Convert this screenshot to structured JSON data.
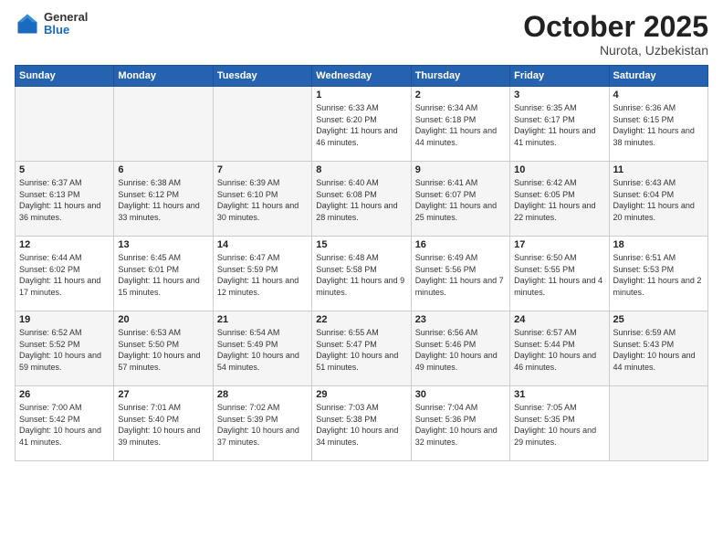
{
  "header": {
    "logo": {
      "general": "General",
      "blue": "Blue"
    },
    "title": "October 2025",
    "subtitle": "Nurota, Uzbekistan"
  },
  "weekdays": [
    "Sunday",
    "Monday",
    "Tuesday",
    "Wednesday",
    "Thursday",
    "Friday",
    "Saturday"
  ],
  "rows": [
    {
      "cells": [
        {
          "empty": true
        },
        {
          "empty": true
        },
        {
          "empty": true
        },
        {
          "day": "1",
          "sunrise": "Sunrise: 6:33 AM",
          "sunset": "Sunset: 6:20 PM",
          "daylight": "Daylight: 11 hours and 46 minutes."
        },
        {
          "day": "2",
          "sunrise": "Sunrise: 6:34 AM",
          "sunset": "Sunset: 6:18 PM",
          "daylight": "Daylight: 11 hours and 44 minutes."
        },
        {
          "day": "3",
          "sunrise": "Sunrise: 6:35 AM",
          "sunset": "Sunset: 6:17 PM",
          "daylight": "Daylight: 11 hours and 41 minutes."
        },
        {
          "day": "4",
          "sunrise": "Sunrise: 6:36 AM",
          "sunset": "Sunset: 6:15 PM",
          "daylight": "Daylight: 11 hours and 38 minutes."
        }
      ]
    },
    {
      "cells": [
        {
          "day": "5",
          "sunrise": "Sunrise: 6:37 AM",
          "sunset": "Sunset: 6:13 PM",
          "daylight": "Daylight: 11 hours and 36 minutes."
        },
        {
          "day": "6",
          "sunrise": "Sunrise: 6:38 AM",
          "sunset": "Sunset: 6:12 PM",
          "daylight": "Daylight: 11 hours and 33 minutes."
        },
        {
          "day": "7",
          "sunrise": "Sunrise: 6:39 AM",
          "sunset": "Sunset: 6:10 PM",
          "daylight": "Daylight: 11 hours and 30 minutes."
        },
        {
          "day": "8",
          "sunrise": "Sunrise: 6:40 AM",
          "sunset": "Sunset: 6:08 PM",
          "daylight": "Daylight: 11 hours and 28 minutes."
        },
        {
          "day": "9",
          "sunrise": "Sunrise: 6:41 AM",
          "sunset": "Sunset: 6:07 PM",
          "daylight": "Daylight: 11 hours and 25 minutes."
        },
        {
          "day": "10",
          "sunrise": "Sunrise: 6:42 AM",
          "sunset": "Sunset: 6:05 PM",
          "daylight": "Daylight: 11 hours and 22 minutes."
        },
        {
          "day": "11",
          "sunrise": "Sunrise: 6:43 AM",
          "sunset": "Sunset: 6:04 PM",
          "daylight": "Daylight: 11 hours and 20 minutes."
        }
      ]
    },
    {
      "cells": [
        {
          "day": "12",
          "sunrise": "Sunrise: 6:44 AM",
          "sunset": "Sunset: 6:02 PM",
          "daylight": "Daylight: 11 hours and 17 minutes."
        },
        {
          "day": "13",
          "sunrise": "Sunrise: 6:45 AM",
          "sunset": "Sunset: 6:01 PM",
          "daylight": "Daylight: 11 hours and 15 minutes."
        },
        {
          "day": "14",
          "sunrise": "Sunrise: 6:47 AM",
          "sunset": "Sunset: 5:59 PM",
          "daylight": "Daylight: 11 hours and 12 minutes."
        },
        {
          "day": "15",
          "sunrise": "Sunrise: 6:48 AM",
          "sunset": "Sunset: 5:58 PM",
          "daylight": "Daylight: 11 hours and 9 minutes."
        },
        {
          "day": "16",
          "sunrise": "Sunrise: 6:49 AM",
          "sunset": "Sunset: 5:56 PM",
          "daylight": "Daylight: 11 hours and 7 minutes."
        },
        {
          "day": "17",
          "sunrise": "Sunrise: 6:50 AM",
          "sunset": "Sunset: 5:55 PM",
          "daylight": "Daylight: 11 hours and 4 minutes."
        },
        {
          "day": "18",
          "sunrise": "Sunrise: 6:51 AM",
          "sunset": "Sunset: 5:53 PM",
          "daylight": "Daylight: 11 hours and 2 minutes."
        }
      ]
    },
    {
      "cells": [
        {
          "day": "19",
          "sunrise": "Sunrise: 6:52 AM",
          "sunset": "Sunset: 5:52 PM",
          "daylight": "Daylight: 10 hours and 59 minutes."
        },
        {
          "day": "20",
          "sunrise": "Sunrise: 6:53 AM",
          "sunset": "Sunset: 5:50 PM",
          "daylight": "Daylight: 10 hours and 57 minutes."
        },
        {
          "day": "21",
          "sunrise": "Sunrise: 6:54 AM",
          "sunset": "Sunset: 5:49 PM",
          "daylight": "Daylight: 10 hours and 54 minutes."
        },
        {
          "day": "22",
          "sunrise": "Sunrise: 6:55 AM",
          "sunset": "Sunset: 5:47 PM",
          "daylight": "Daylight: 10 hours and 51 minutes."
        },
        {
          "day": "23",
          "sunrise": "Sunrise: 6:56 AM",
          "sunset": "Sunset: 5:46 PM",
          "daylight": "Daylight: 10 hours and 49 minutes."
        },
        {
          "day": "24",
          "sunrise": "Sunrise: 6:57 AM",
          "sunset": "Sunset: 5:44 PM",
          "daylight": "Daylight: 10 hours and 46 minutes."
        },
        {
          "day": "25",
          "sunrise": "Sunrise: 6:59 AM",
          "sunset": "Sunset: 5:43 PM",
          "daylight": "Daylight: 10 hours and 44 minutes."
        }
      ]
    },
    {
      "cells": [
        {
          "day": "26",
          "sunrise": "Sunrise: 7:00 AM",
          "sunset": "Sunset: 5:42 PM",
          "daylight": "Daylight: 10 hours and 41 minutes."
        },
        {
          "day": "27",
          "sunrise": "Sunrise: 7:01 AM",
          "sunset": "Sunset: 5:40 PM",
          "daylight": "Daylight: 10 hours and 39 minutes."
        },
        {
          "day": "28",
          "sunrise": "Sunrise: 7:02 AM",
          "sunset": "Sunset: 5:39 PM",
          "daylight": "Daylight: 10 hours and 37 minutes."
        },
        {
          "day": "29",
          "sunrise": "Sunrise: 7:03 AM",
          "sunset": "Sunset: 5:38 PM",
          "daylight": "Daylight: 10 hours and 34 minutes."
        },
        {
          "day": "30",
          "sunrise": "Sunrise: 7:04 AM",
          "sunset": "Sunset: 5:36 PM",
          "daylight": "Daylight: 10 hours and 32 minutes."
        },
        {
          "day": "31",
          "sunrise": "Sunrise: 7:05 AM",
          "sunset": "Sunset: 5:35 PM",
          "daylight": "Daylight: 10 hours and 29 minutes."
        },
        {
          "empty": true
        }
      ]
    }
  ]
}
